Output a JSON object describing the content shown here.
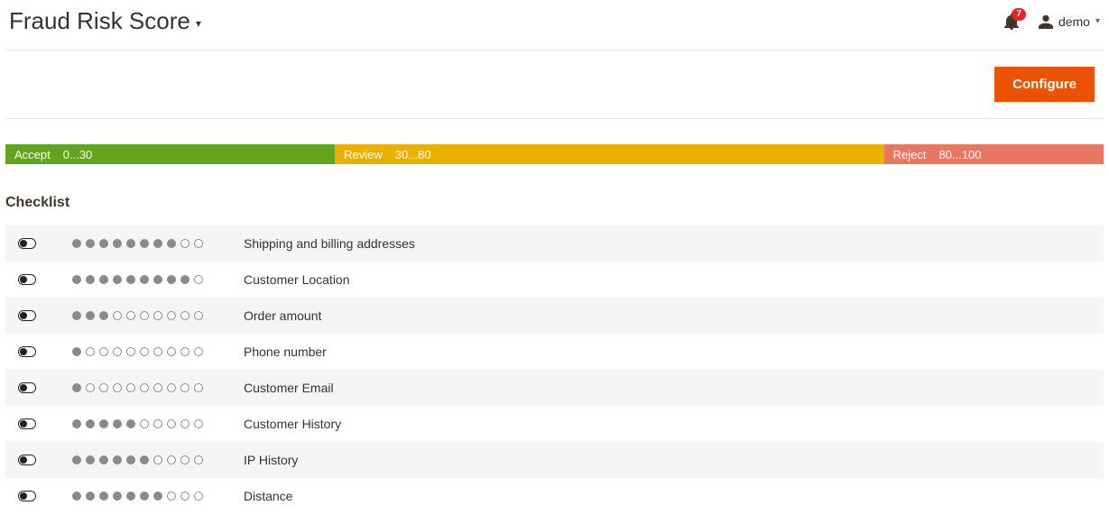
{
  "header": {
    "title": "Fraud Risk Score",
    "notification_count": "7",
    "user_label": "demo"
  },
  "actions": {
    "configure_label": "Configure"
  },
  "score_bar": {
    "accept": {
      "label": "Accept",
      "range": "0...30"
    },
    "review": {
      "label": "Review",
      "range": "30...80"
    },
    "reject": {
      "label": "Reject",
      "range": "80...100"
    }
  },
  "checklist_title": "Checklist",
  "checklist": [
    {
      "label": "Shipping and billing addresses",
      "enabled": true,
      "weight": 8,
      "max": 10
    },
    {
      "label": "Customer Location",
      "enabled": true,
      "weight": 9,
      "max": 10
    },
    {
      "label": "Order amount",
      "enabled": true,
      "weight": 3,
      "max": 10
    },
    {
      "label": "Phone number",
      "enabled": true,
      "weight": 1,
      "max": 10
    },
    {
      "label": "Customer Email",
      "enabled": true,
      "weight": 1,
      "max": 10
    },
    {
      "label": "Customer History",
      "enabled": true,
      "weight": 5,
      "max": 10
    },
    {
      "label": "IP History",
      "enabled": true,
      "weight": 6,
      "max": 10
    },
    {
      "label": "Distance",
      "enabled": true,
      "weight": 7,
      "max": 10
    }
  ]
}
